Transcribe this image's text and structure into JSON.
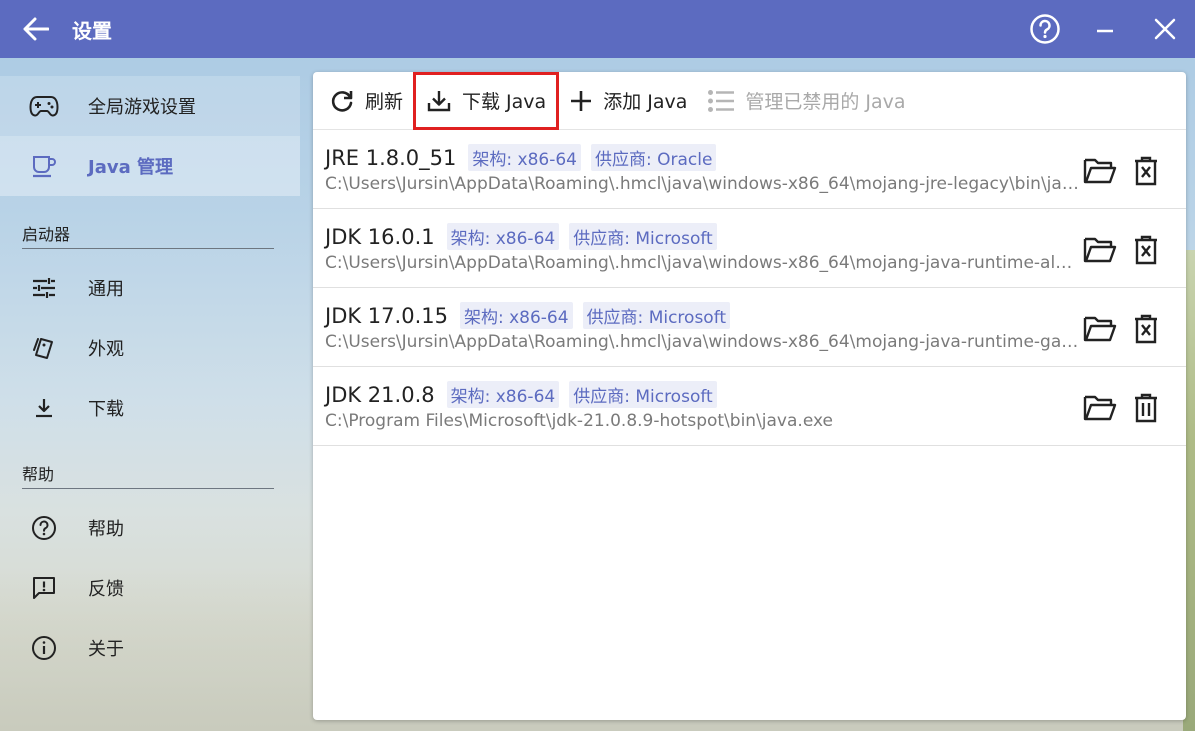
{
  "window": {
    "title": "设置"
  },
  "sidebar": {
    "top_items": [
      {
        "label": "全局游戏设置",
        "icon": "gamepad-icon"
      },
      {
        "label": "Java 管理",
        "icon": "coffee-cup-icon",
        "active": true
      }
    ],
    "sections": [
      {
        "label": "启动器",
        "items": [
          {
            "label": "通用",
            "icon": "tune-icon"
          },
          {
            "label": "外观",
            "icon": "style-icon"
          },
          {
            "label": "下载",
            "icon": "download-icon"
          }
        ]
      },
      {
        "label": "帮助",
        "items": [
          {
            "label": "帮助",
            "icon": "help-icon"
          },
          {
            "label": "反馈",
            "icon": "feedback-icon"
          },
          {
            "label": "关于",
            "icon": "info-icon"
          }
        ]
      }
    ]
  },
  "toolbar": {
    "refresh": "刷新",
    "download_java": "下载 Java",
    "add_java": "添加 Java",
    "manage_disabled": "管理已禁用的 Java"
  },
  "java_list": [
    {
      "name": "JRE 1.8.0_51",
      "arch": "架构: x86-64",
      "vendor": "供应商: Oracle",
      "path": "C:\\Users\\Jursin\\AppData\\Roaming\\.hmcl\\java\\windows-x86_64\\mojang-jre-legacy\\bin\\java.exe",
      "action": "disable"
    },
    {
      "name": "JDK 16.0.1",
      "arch": "架构: x86-64",
      "vendor": "供应商: Microsoft",
      "path": "C:\\Users\\Jursin\\AppData\\Roaming\\.hmcl\\java\\windows-x86_64\\mojang-java-runtime-alpha\\bin\\java.exe",
      "action": "disable"
    },
    {
      "name": "JDK 17.0.15",
      "arch": "架构: x86-64",
      "vendor": "供应商: Microsoft",
      "path": "C:\\Users\\Jursin\\AppData\\Roaming\\.hmcl\\java\\windows-x86_64\\mojang-java-runtime-gamma\\bin\\java.exe",
      "action": "disable"
    },
    {
      "name": "JDK 21.0.8",
      "arch": "架构: x86-64",
      "vendor": "供应商: Microsoft",
      "path": "C:\\Program Files\\Microsoft\\jdk-21.0.8.9-hotspot\\bin\\java.exe",
      "action": "delete"
    }
  ],
  "colors": {
    "accent": "#5c6bc0",
    "highlight_border": "#e02020"
  }
}
